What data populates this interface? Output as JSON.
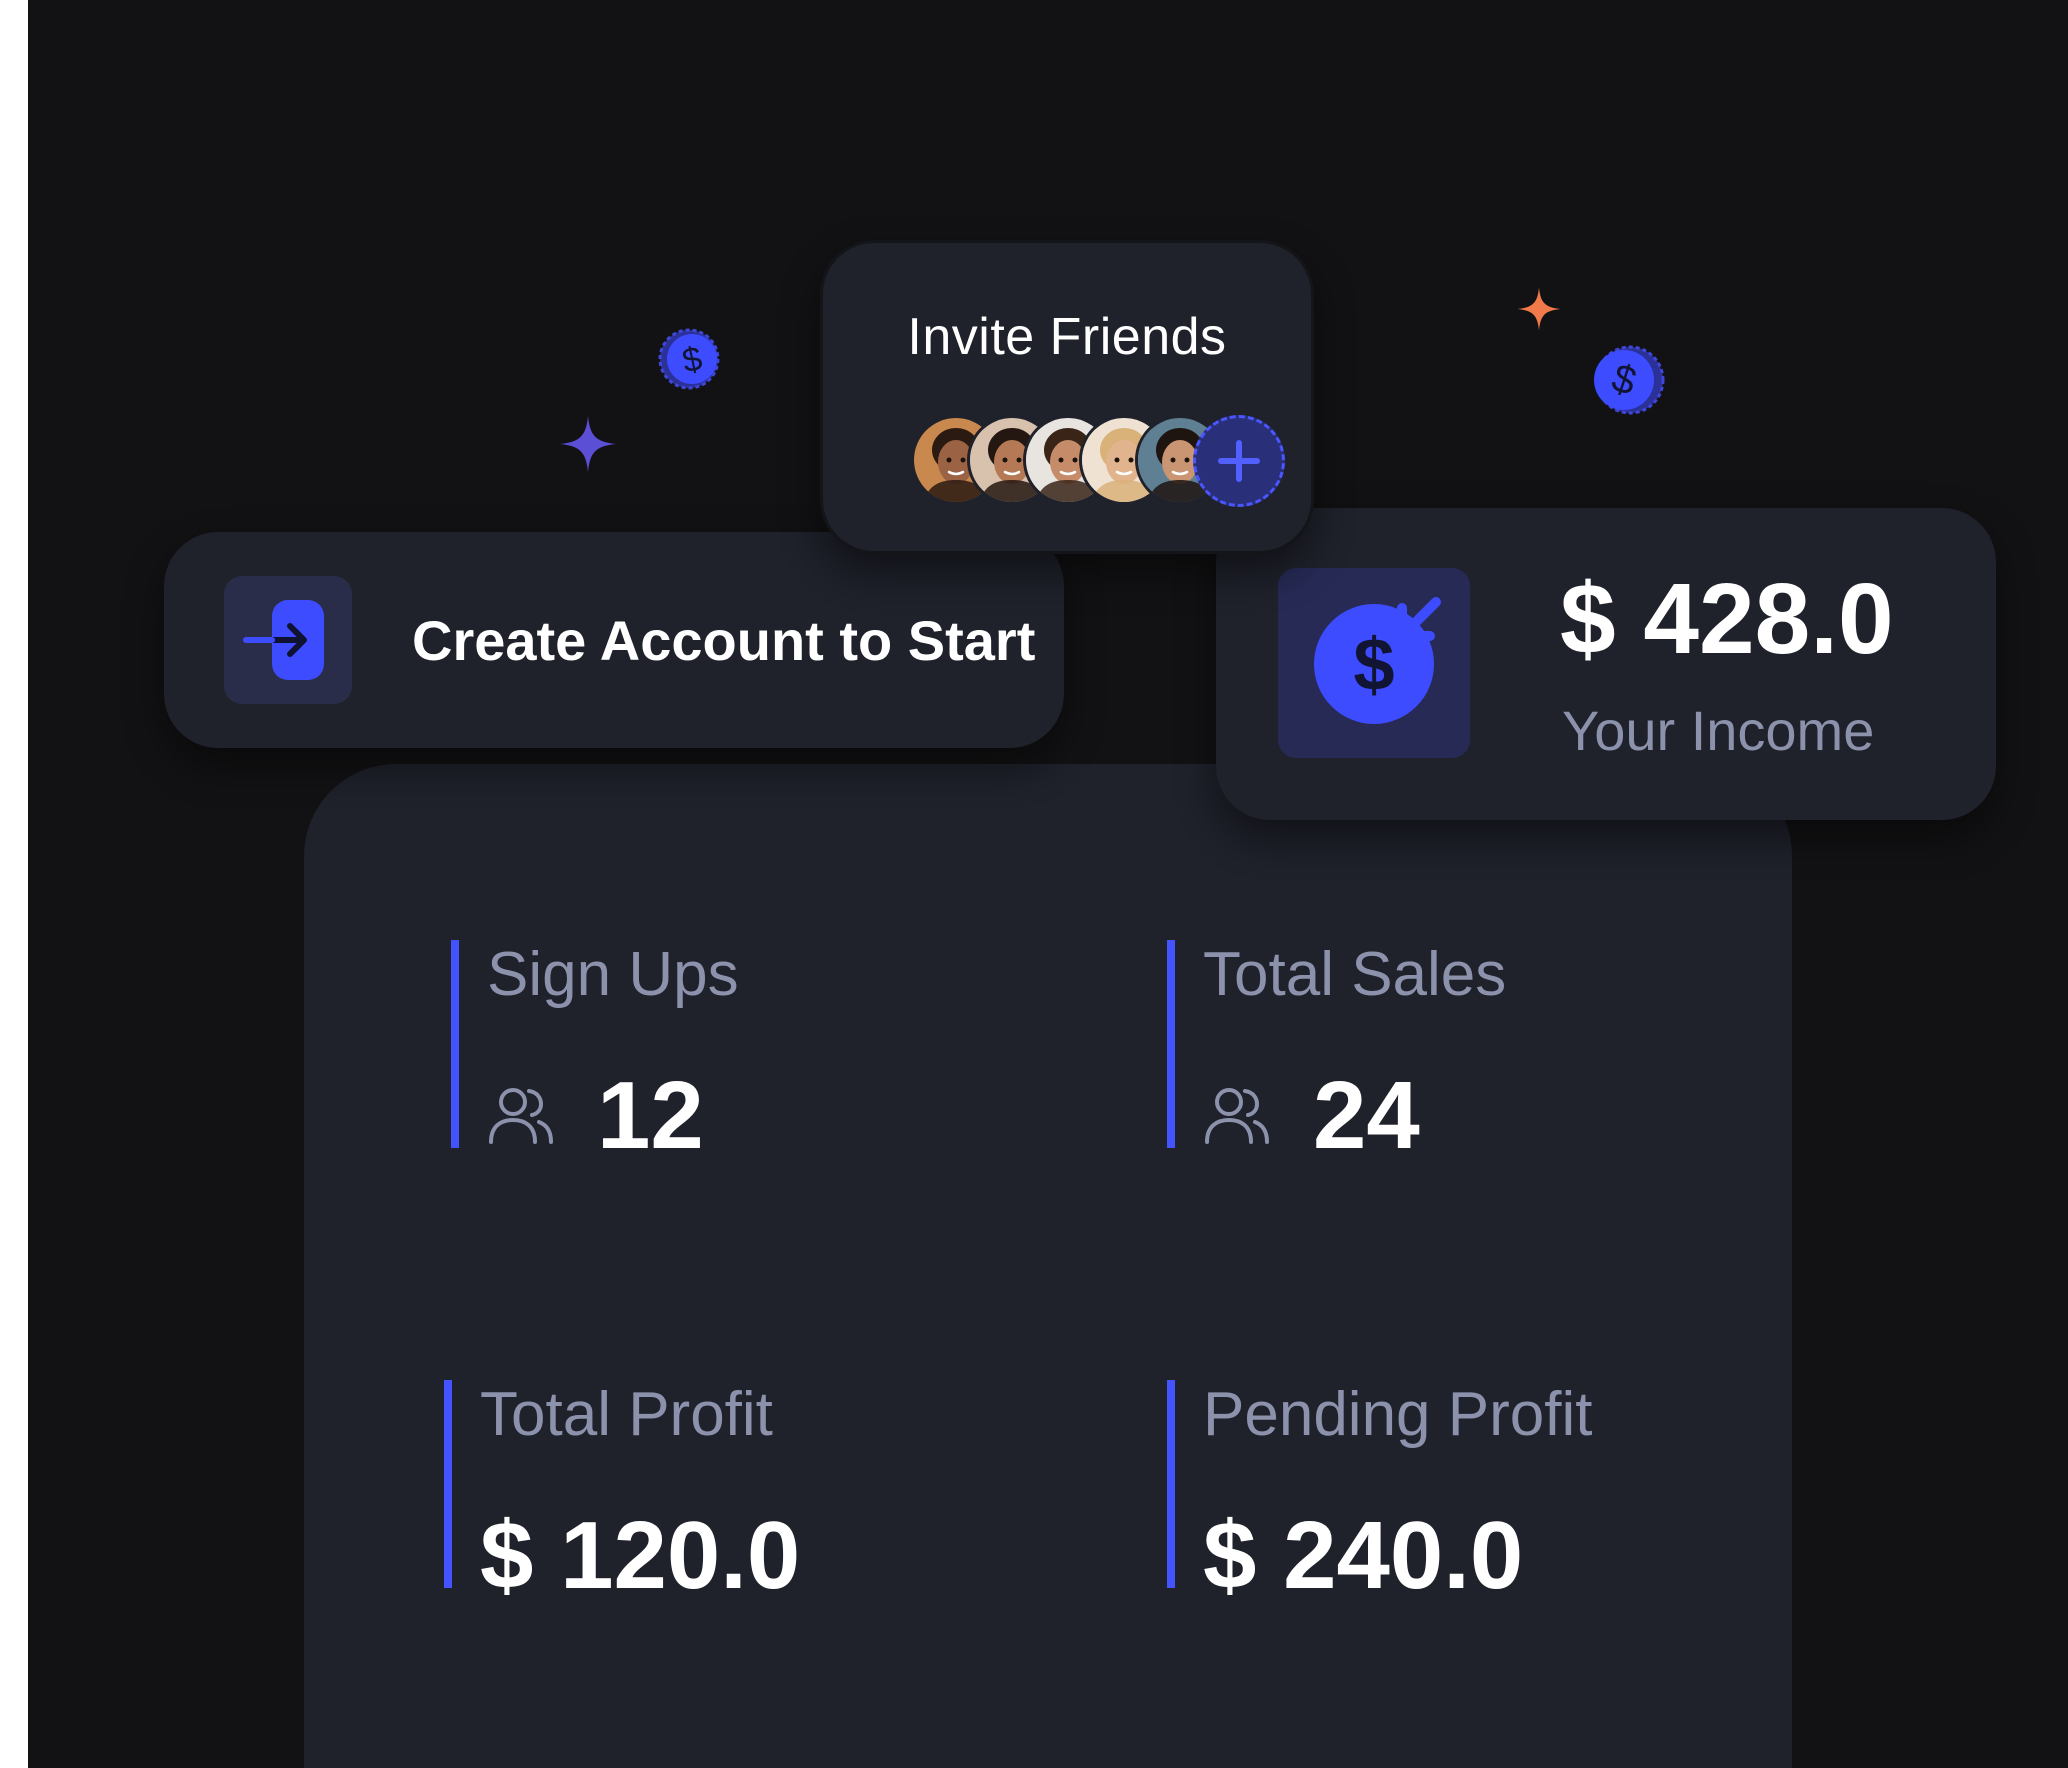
{
  "invite": {
    "title": "Invite Friends",
    "avatars": [
      {
        "name": "friend-avatar-1",
        "skin": "#9b6244",
        "hair": "#2a1a12",
        "bg": "#c9884d"
      },
      {
        "name": "friend-avatar-2",
        "skin": "#b57a55",
        "hair": "#241610",
        "bg": "#d8c2ae"
      },
      {
        "name": "friend-avatar-3",
        "skin": "#c68c69",
        "hair": "#3a2418",
        "bg": "#e8e4e0"
      },
      {
        "name": "friend-avatar-4",
        "skin": "#e2b48e",
        "hair": "#d9b27a",
        "bg": "#efe2d2"
      },
      {
        "name": "friend-avatar-5",
        "skin": "#c99572",
        "hair": "#1e1410",
        "bg": "#5f7f93"
      }
    ],
    "add_icon": "plus-icon"
  },
  "create_account": {
    "label": "Create Account to Start",
    "icon": "login-arrow-icon"
  },
  "income": {
    "amount": "$ 428.0",
    "label": "Your Income",
    "icon": "dollar-coin-incoming-icon"
  },
  "stats": {
    "signups": {
      "label": "Sign Ups",
      "value": "12",
      "icon": "users-icon"
    },
    "sales": {
      "label": "Total Sales",
      "value": "24",
      "icon": "users-icon"
    },
    "profit": {
      "label": "Total Profit",
      "value": "$ 120.0"
    },
    "pending": {
      "label": "Pending Profit",
      "value": "$ 240.0"
    }
  },
  "colors": {
    "background": "#121214",
    "card": "#1f212b",
    "accent": "#4353ff",
    "muted_text": "#8c92ab",
    "sparkle_purple": "#5b4fd6",
    "sparkle_orange": "#f07a4a"
  }
}
